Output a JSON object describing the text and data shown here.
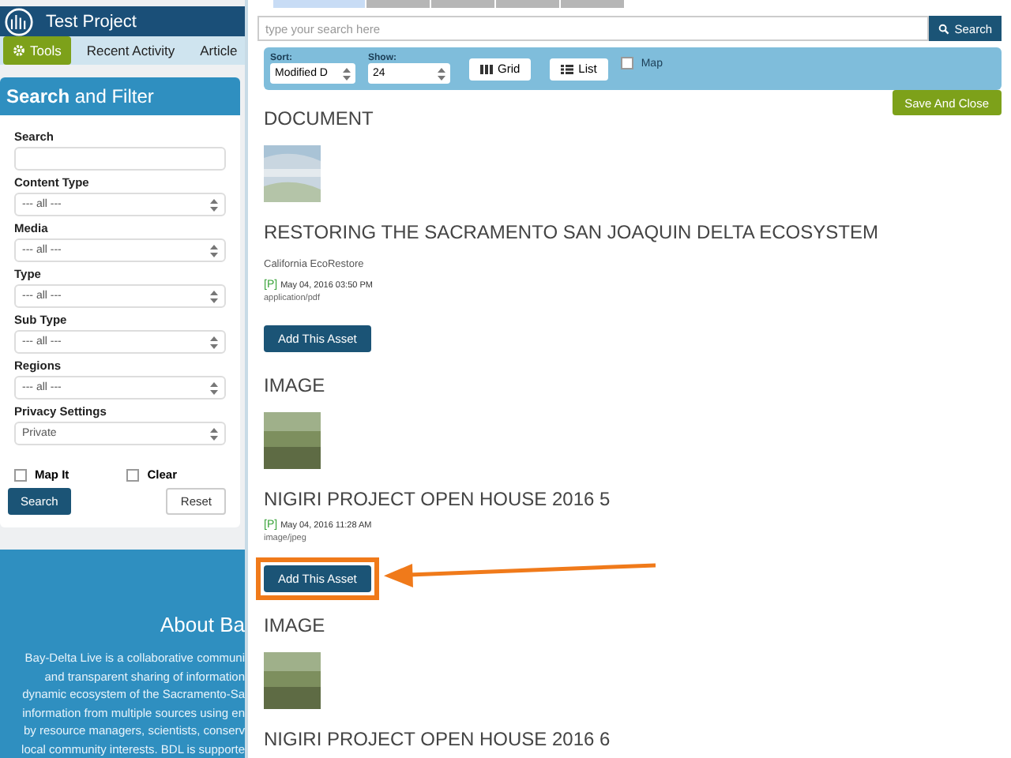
{
  "header": {
    "project_title": "Test Project"
  },
  "nav": [
    {
      "label": "Tools",
      "selected": true
    },
    {
      "label": "Recent Activity",
      "selected": false
    },
    {
      "label": "Article",
      "selected": false
    }
  ],
  "filter": {
    "title": "**Search** and Filter",
    "fields": [
      {
        "kind": "text",
        "label": "Search"
      },
      {
        "kind": "select",
        "label": "Content Type",
        "value": "--- all ---"
      },
      {
        "kind": "select",
        "label": "Media",
        "value": "--- all ---"
      },
      {
        "kind": "select",
        "label": "Type",
        "value": "--- all ---"
      },
      {
        "kind": "select",
        "label": "Sub Type",
        "value": "--- all ---"
      },
      {
        "kind": "select",
        "label": "Regions",
        "value": "--- all ---"
      },
      {
        "kind": "select",
        "label": "Privacy Settings",
        "value": "Private"
      }
    ],
    "checkboxes": [
      {
        "label": "Map It",
        "checked": false
      },
      {
        "label": "Clear",
        "checked": false
      }
    ],
    "search_button": "Search",
    "reset_button": "Reset"
  },
  "about": {
    "heading": "About Ba",
    "lines": [
      "Bay-Delta Live is a collaborative communi",
      "and transparent sharing of information",
      "dynamic ecosystem of the Sacramento-Sa",
      "information from multiple sources using en",
      "by resource managers, scientists, conserv",
      "local community interests. BDL is supporte"
    ]
  },
  "modal": {
    "tabs": [
      {
        "selected": true
      },
      {
        "selected": false
      },
      {
        "selected": false
      },
      {
        "selected": false
      },
      {
        "selected": false
      }
    ],
    "search": {
      "placeholder": "type your search here",
      "button": "Search"
    },
    "toolbar": {
      "sort": {
        "label": "Sort:",
        "value": "Modified D"
      },
      "show": {
        "label": "Show:",
        "value": "24"
      },
      "views": [
        {
          "kind": "grid",
          "label": "Grid"
        },
        {
          "kind": "list",
          "label": "List"
        }
      ],
      "map": {
        "label": "Map",
        "checked": false
      }
    },
    "save_button": "Save And Close",
    "results": [
      {
        "type": "DOCUMENT",
        "kind": "document",
        "title": "RESTORING THE SACRAMENTO SAN JOAQUIN DELTA ECOSYSTEM",
        "source": "California EcoRestore",
        "privacy": "[P]",
        "date": "May 04, 2016 03:50 PM",
        "mime": "application/pdf",
        "button": "Add This Asset",
        "highlighted": false
      },
      {
        "type": "IMAGE",
        "kind": "photo",
        "title": "NIGIRI PROJECT OPEN HOUSE 2016 5",
        "privacy": "[P]",
        "date": "May 04, 2016 11:28 AM",
        "mime": "image/jpeg",
        "button": "Add This Asset",
        "highlighted": true
      },
      {
        "type": "IMAGE",
        "kind": "photo",
        "title": "NIGIRI PROJECT OPEN HOUSE 2016 6",
        "highlighted": false
      }
    ]
  }
}
